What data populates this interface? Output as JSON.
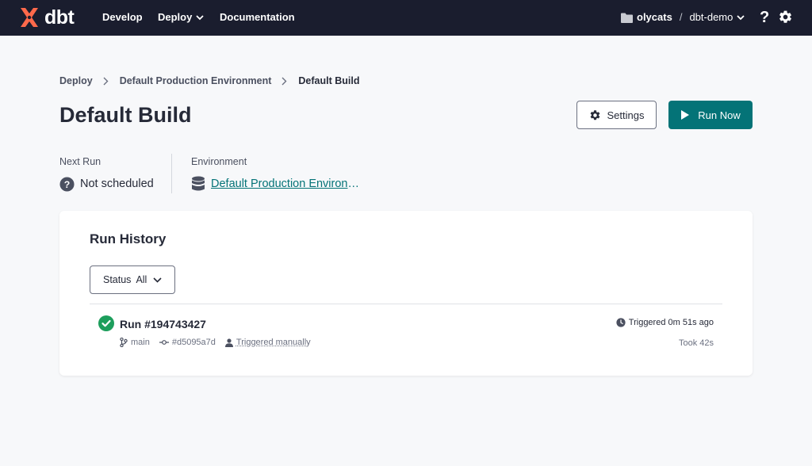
{
  "nav": {
    "logo_text": "dbt",
    "items": [
      {
        "label": "Develop"
      },
      {
        "label": "Deploy"
      },
      {
        "label": "Documentation"
      }
    ],
    "account": "olycats",
    "separator": "/",
    "project": "dbt-demo",
    "help": "?"
  },
  "breadcrumb": {
    "items": [
      "Deploy",
      "Default Production Environment",
      "Default Build"
    ]
  },
  "page": {
    "title": "Default Build",
    "settings_label": "Settings",
    "run_now_label": "Run Now"
  },
  "meta": {
    "next_run_label": "Next Run",
    "next_run_value": "Not scheduled",
    "environment_label": "Environment",
    "environment_value": "Default Production Environment"
  },
  "run_history": {
    "title": "Run History",
    "filter_label": "Status",
    "filter_value": "All",
    "runs": [
      {
        "title": "Run #194743427",
        "status": "success",
        "branch": "main",
        "commit": "#d5095a7d",
        "trigger": "Triggered manually",
        "triggered_at": "Triggered 0m 51s ago",
        "duration": "Took 42s"
      }
    ]
  },
  "colors": {
    "nav_bg": "#1a1d2e",
    "brand_orange": "#ff694b",
    "accent_teal": "#047377",
    "success_green": "#1d9e5c",
    "page_bg": "#f7f8fa"
  },
  "icons": [
    "dbt-logo-icon",
    "chevron-down-icon",
    "folder-icon",
    "help-icon",
    "gear-icon",
    "chevron-right-icon",
    "play-icon",
    "question-circle-icon",
    "database-icon",
    "check-circle-icon",
    "branch-icon",
    "commit-icon",
    "user-icon",
    "clock-icon"
  ]
}
